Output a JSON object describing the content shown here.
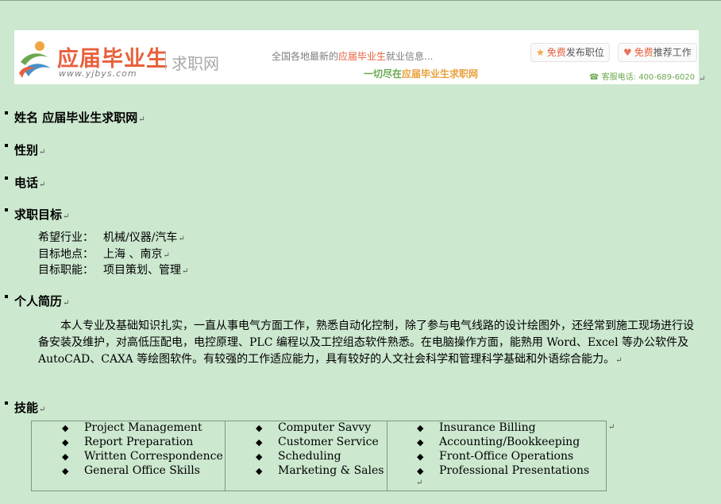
{
  "banner": {
    "brand": "应届毕业生",
    "url": "www.yjbys.com",
    "subtitle": "求职网",
    "slogan_prefix": "全国各地最新的",
    "slogan_highlight": "应届毕业生",
    "slogan_suffix": "就业信息...",
    "slogan2_prefix": "一切尽在",
    "slogan2_highlight": "应届毕业生求职网",
    "btn_post_free": "免费",
    "btn_post_label": "发布职位",
    "btn_recommend_free": "免费",
    "btn_recommend_label": "推荐工作",
    "hotline": "客服电话: 400-689-6020"
  },
  "para_mark": "↵",
  "sections": {
    "name": "姓名 应届毕业生求职网",
    "gender": "性别",
    "phone": "电话",
    "goal": "求职目标",
    "intro": "个人简历",
    "skills": "技能"
  },
  "goal": {
    "industry_label": "希望行业：",
    "industry_value": "机械/仪器/汽车",
    "location_label": "目标地点：",
    "location_value": "上海 、南京",
    "role_label": "目标职能：",
    "role_value": "项目策划、管理"
  },
  "intro_text": "本人专业及基础知识扎实，一直从事电气方面工作，熟悉自动化控制，除了参与电气线路的设计绘图外，还经常到施工现场进行设备安装及维护，对高低压配电，电控原理、PLC 编程以及工控组态软件熟悉。在电脑操作方面，能熟用 Word、Excel 等办公软件及 AutoCAD、CAXA 等绘图软件。有较强的工作适应能力，具有较好的人文社会科学和管理科学基础和外语综合能力。",
  "skills": {
    "bullet": "◆",
    "col1": [
      "Project Management",
      "Report Preparation",
      "Written Correspondence",
      "General Office Skills"
    ],
    "col2": [
      "Computer Savvy",
      "Customer Service",
      "Scheduling",
      "Marketing & Sales"
    ],
    "col3": [
      "Insurance Billing",
      "Accounting/Bookkeeping",
      "Front-Office Operations",
      "Professional Presentations"
    ]
  },
  "colors": {
    "background": "#cce8cf",
    "brand": "#e8603c",
    "accent_green": "#6aa84f"
  }
}
